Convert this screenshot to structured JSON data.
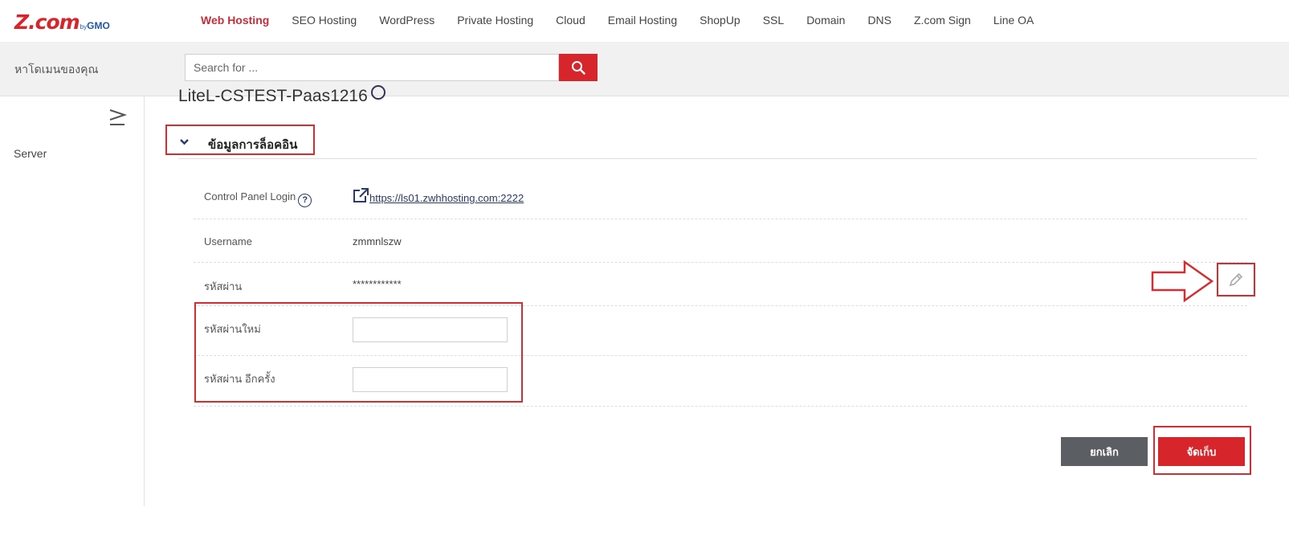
{
  "logo": {
    "main": "Z.com",
    "by": "by",
    "gmo": "GMO"
  },
  "nav": {
    "items": [
      {
        "label": "Web Hosting",
        "active": true
      },
      {
        "label": "SEO Hosting"
      },
      {
        "label": "WordPress"
      },
      {
        "label": "Private Hosting"
      },
      {
        "label": "Cloud"
      },
      {
        "label": "Email Hosting"
      },
      {
        "label": "ShopUp"
      },
      {
        "label": "SSL"
      },
      {
        "label": "Domain"
      },
      {
        "label": "DNS"
      },
      {
        "label": "Z.com Sign"
      },
      {
        "label": "Line OA"
      }
    ]
  },
  "search": {
    "label": "หาโดเมนของคุณ",
    "placeholder": "Search for ...",
    "icon": "search-icon"
  },
  "sidebar": {
    "items": [
      {
        "label": "Server"
      }
    ]
  },
  "main": {
    "title_partial": "LiteL-CSTEST-Paas1216",
    "section_title": "ข้อมูลการล็อคอิน",
    "rows": {
      "cp_label": "Control Panel Login",
      "cp_link": "https://ls01.zwhhosting.com:2222",
      "username_label": "Username",
      "username_value": "zmmnlszw",
      "password_label": "รหัสผ่าน",
      "password_value": "************",
      "new_password_label": "รหัสผ่านใหม่",
      "confirm_password_label": "รหัสผ่าน อีกครั้ง"
    }
  },
  "buttons": {
    "cancel": "ยกเลิก",
    "save": "จัดเก็บ"
  },
  "colors": {
    "brand_red": "#d7262b",
    "highlight_red": "#d32f33",
    "navy": "#2b3a67",
    "cancel_gray": "#5b5f63"
  }
}
